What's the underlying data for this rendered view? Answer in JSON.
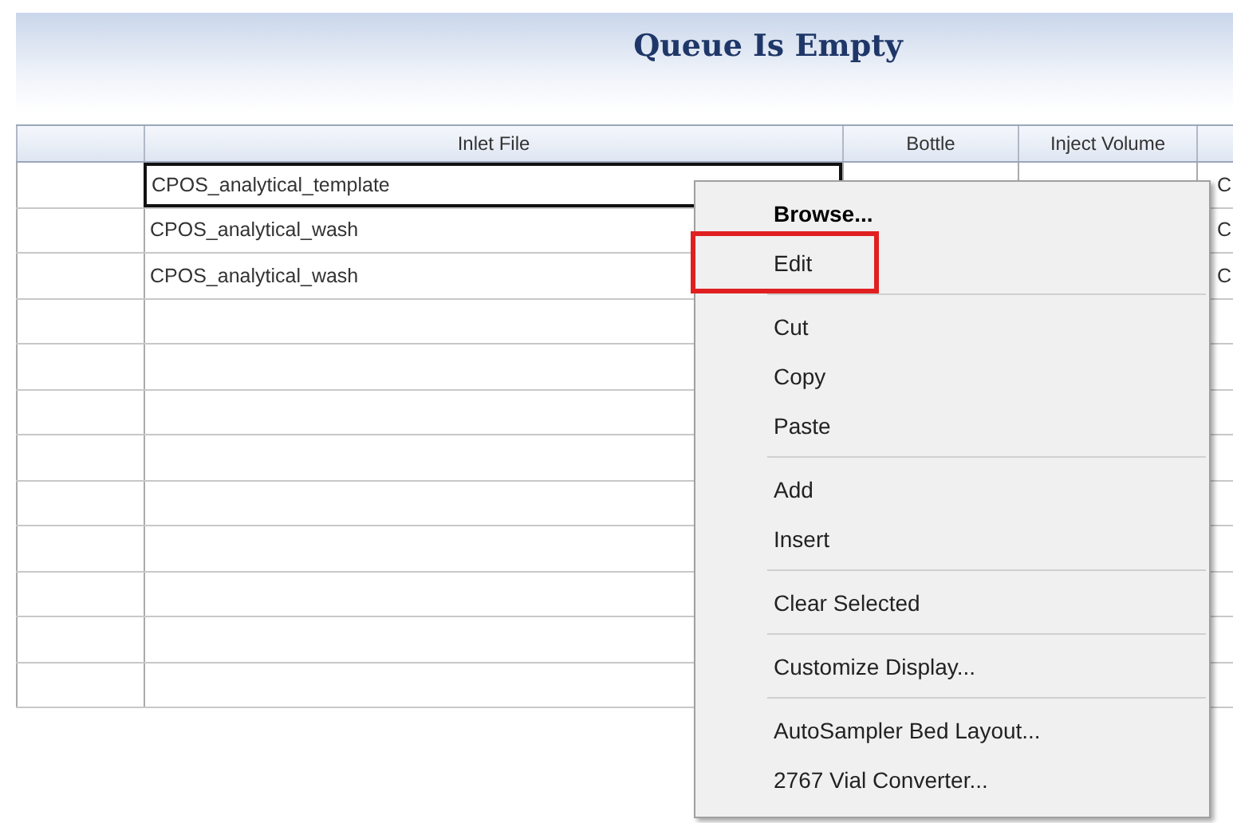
{
  "banner": {
    "title": "Queue Is Empty"
  },
  "table": {
    "columns": [
      {},
      {
        "label": "Inlet File"
      },
      {
        "label": "Bottle"
      },
      {
        "label": "Inject Volume"
      },
      {}
    ],
    "rows": [
      {
        "selected": true,
        "inlet_file": "CPOS_analytical_template",
        "column_5": "C"
      },
      {
        "selected": false,
        "inlet_file": "CPOS_analytical_wash",
        "column_5": "C"
      },
      {
        "selected": false,
        "inlet_file": "CPOS_analytical_wash",
        "column_5": "C"
      },
      {
        "selected": false
      },
      {
        "selected": false
      },
      {
        "selected": false
      },
      {
        "selected": false
      },
      {
        "selected": false
      },
      {
        "selected": false
      },
      {
        "selected": false
      },
      {
        "selected": false
      },
      {
        "selected": false
      }
    ]
  },
  "context_menu": {
    "groups": [
      {
        "items": [
          {
            "label": "Browse...",
            "kind": "default",
            "highlighted": false
          },
          {
            "label": "Edit",
            "kind": "command",
            "highlighted": true
          }
        ]
      },
      {
        "items": [
          {
            "label": "Cut",
            "kind": "command",
            "highlighted": false
          },
          {
            "label": "Copy",
            "kind": "command",
            "highlighted": false
          },
          {
            "label": "Paste",
            "kind": "command",
            "highlighted": false
          }
        ]
      },
      {
        "items": [
          {
            "label": "Add",
            "kind": "command",
            "highlighted": false
          },
          {
            "label": "Insert",
            "kind": "command",
            "highlighted": false
          }
        ]
      },
      {
        "items": [
          {
            "label": "Clear Selected",
            "kind": "command",
            "highlighted": false
          }
        ]
      },
      {
        "items": [
          {
            "label": "Customize Display...",
            "kind": "command",
            "highlighted": false
          }
        ]
      },
      {
        "items": [
          {
            "label": "AutoSampler Bed Layout...",
            "kind": "command",
            "highlighted": false
          },
          {
            "label": "2767 Vial Converter...",
            "kind": "command",
            "highlighted": false
          }
        ]
      }
    ]
  }
}
